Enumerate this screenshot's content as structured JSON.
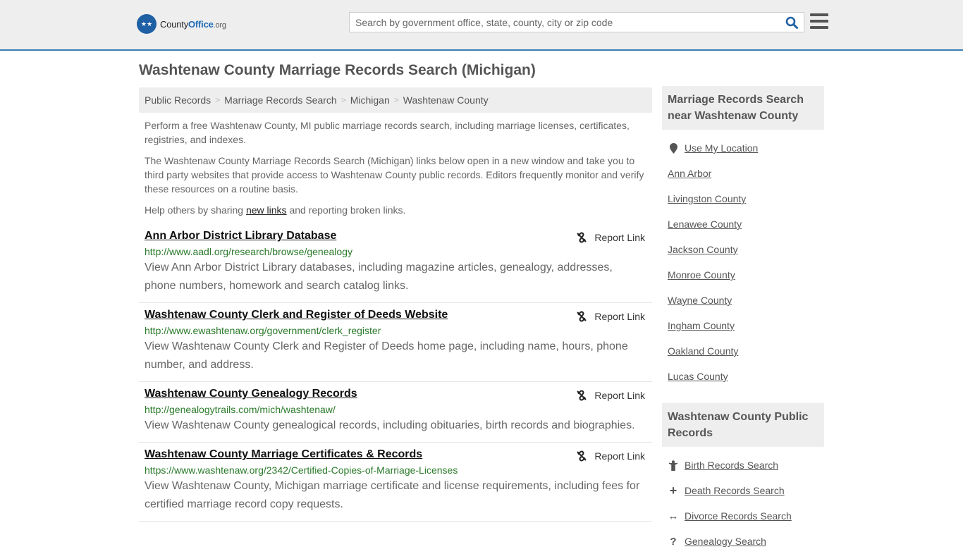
{
  "header": {
    "logo": {
      "county": "County",
      "office": "Office",
      "tld": ".org"
    },
    "search_placeholder": "Search by government office, state, county, city or zip code"
  },
  "page_title": "Washtenaw County Marriage Records Search (Michigan)",
  "breadcrumbs": [
    "Public Records",
    "Marriage Records Search",
    "Michigan",
    "Washtenaw County"
  ],
  "intro": {
    "p1": "Perform a free Washtenaw County, MI public marriage records search, including marriage licenses, certificates, registries, and indexes.",
    "p2": "The Washtenaw County Marriage Records Search (Michigan) links below open in a new window and take you to third party websites that provide access to Washtenaw County public records. Editors frequently monitor and verify these resources on a routine basis.",
    "p3_before": "Help others by sharing ",
    "p3_link": "new links",
    "p3_after": " and reporting broken links."
  },
  "report_label": "Report Link",
  "results": [
    {
      "title": "Ann Arbor District Library Database",
      "url": "http://www.aadl.org/research/browse/genealogy",
      "desc": "View Ann Arbor District Library databases, including magazine articles, genealogy, addresses, phone numbers, homework and search catalog links."
    },
    {
      "title": "Washtenaw County Clerk and Register of Deeds Website",
      "url": "http://www.ewashtenaw.org/government/clerk_register",
      "desc": "View Washtenaw County Clerk and Register of Deeds home page, including name, hours, phone number, and address."
    },
    {
      "title": "Washtenaw County Genealogy Records",
      "url": "http://genealogytrails.com/mich/washtenaw/",
      "desc": "View Washtenaw County genealogical records, including obituaries, birth records and biographies."
    },
    {
      "title": "Washtenaw County Marriage Certificates & Records",
      "url": "https://www.washtenaw.org/2342/Certified-Copies-of-Marriage-Licenses",
      "desc": "View Washtenaw County, Michigan marriage certificate and license requirements, including fees for certified marriage record copy requests."
    }
  ],
  "sidebar": {
    "nearby_heading": "Marriage Records Search near Washtenaw County",
    "use_location": "Use My Location",
    "nearby": [
      "Ann Arbor",
      "Livingston County",
      "Lenawee County",
      "Jackson County",
      "Monroe County",
      "Wayne County",
      "Ingham County",
      "Oakland County",
      "Lucas County"
    ],
    "public_heading": "Washtenaw County Public Records",
    "public_links": [
      {
        "icon": "child-icon",
        "label": "Birth Records Search"
      },
      {
        "icon": "cross-icon",
        "label": "Death Records Search"
      },
      {
        "icon": "arrows-icon",
        "label": "Divorce Records Search"
      },
      {
        "icon": "question-icon",
        "label": "Genealogy Search"
      }
    ]
  }
}
